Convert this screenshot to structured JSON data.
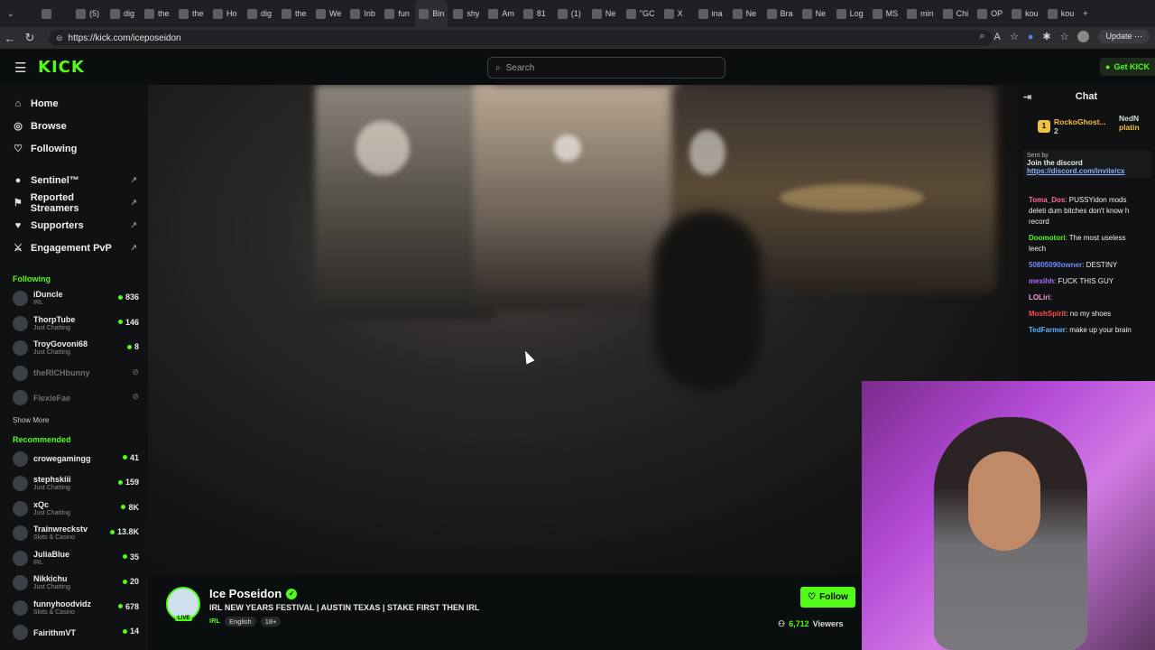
{
  "browser": {
    "tabs": [
      {
        "label": ""
      },
      {
        "label": "(5)"
      },
      {
        "label": "dig"
      },
      {
        "label": "the"
      },
      {
        "label": "the"
      },
      {
        "label": "Ho"
      },
      {
        "label": "dig"
      },
      {
        "label": "the"
      },
      {
        "label": "We"
      },
      {
        "label": "Inb"
      },
      {
        "label": "fun"
      },
      {
        "label": "Bin"
      },
      {
        "label": "shy"
      },
      {
        "label": "Am"
      },
      {
        "label": "81"
      },
      {
        "label": "(1)"
      },
      {
        "label": "Ne"
      },
      {
        "label": "\"GC"
      },
      {
        "label": "X"
      },
      {
        "label": "ina"
      },
      {
        "label": "Ne"
      },
      {
        "label": "Bra"
      },
      {
        "label": "Ne"
      },
      {
        "label": "Log"
      },
      {
        "label": "MS"
      },
      {
        "label": "min"
      },
      {
        "label": "Chi"
      },
      {
        "label": "OP"
      },
      {
        "label": "kou"
      },
      {
        "label": "kou"
      }
    ],
    "url": "https://kick.com/iceposeidon",
    "update_label": "Update"
  },
  "header": {
    "logo": "KICK",
    "search_placeholder": "Search",
    "get_kick": "Get KICK"
  },
  "sidebar": {
    "nav": [
      {
        "label": "Home",
        "icon": "home-icon"
      },
      {
        "label": "Browse",
        "icon": "compass-icon"
      },
      {
        "label": "Following",
        "icon": "heart-icon"
      }
    ],
    "extensions": [
      {
        "label": "Sentinel™"
      },
      {
        "label": "Reported Streamers"
      },
      {
        "label": "Supporters"
      },
      {
        "label": "Engagement PvP"
      }
    ],
    "following_heading": "Following",
    "following": [
      {
        "name": "iDuncle",
        "cat": "IRL",
        "viewers": "836"
      },
      {
        "name": "ThorpTube",
        "cat": "Just Chatting",
        "viewers": "146"
      },
      {
        "name": "TroyGovoni68",
        "cat": "Just Chatting",
        "viewers": "8"
      },
      {
        "name": "theRICHbunny",
        "cat": "",
        "viewers": ""
      },
      {
        "name": "FlexieFae",
        "cat": "",
        "viewers": ""
      }
    ],
    "show_more": "Show More",
    "recommended_heading": "Recommended",
    "recommended": [
      {
        "name": "crowegamingg",
        "cat": "",
        "viewers": "41"
      },
      {
        "name": "stephskiii",
        "cat": "Just Chatting",
        "viewers": "159"
      },
      {
        "name": "xQc",
        "cat": "Just Chatting",
        "viewers": "8K"
      },
      {
        "name": "Trainwreckstv",
        "cat": "Slots & Casino",
        "viewers": "13.8K"
      },
      {
        "name": "JuliaBlue",
        "cat": "IRL",
        "viewers": "35"
      },
      {
        "name": "Nikkichu",
        "cat": "Just Chatting",
        "viewers": "20"
      },
      {
        "name": "funnyhoodvidz",
        "cat": "Slots & Casino",
        "viewers": "678"
      },
      {
        "name": "FairithmVT",
        "cat": "",
        "viewers": "14"
      }
    ]
  },
  "stream": {
    "streamer": "Ice Poseidon",
    "live_badge": "LIVE",
    "title": "IRL NEW YEARS FESTIVAL | AUSTIN TEXAS | STAKE FIRST THEN IRL",
    "category": "IRL",
    "tags": [
      "English",
      "18+"
    ],
    "follow_label": "Follow",
    "viewers": "6,712",
    "viewers_label": "Viewers"
  },
  "chat": {
    "title": "Chat",
    "leader_name": "RockoGhost...",
    "leader_count": "2",
    "leader_right": "NedN",
    "leader_right2": "platin",
    "pinned_by": "Sent by",
    "pinned_text": "Join the discord",
    "pinned_link": "https://discord.com/invite/cx",
    "messages": [
      {
        "user": "Toma_Dos",
        "color": "#ff6b8a",
        "text": "PUSSYidon mods deleti dum bitches don't know h record"
      },
      {
        "user": "Doomotori",
        "color": "#53fc18",
        "text": "The most useless leech"
      },
      {
        "user": "50805090owner",
        "color": "#6f8cff",
        "text": "DESTINY"
      },
      {
        "user": "mexihh",
        "color": "#b06bff",
        "text": "FUCK THIS GUY"
      },
      {
        "user": "LOLiri",
        "color": "#ff9bd2",
        "text": ""
      },
      {
        "user": "MoshSpirit",
        "color": "#ff4d4d",
        "text": "no my shoes"
      },
      {
        "user": "TedFarmer",
        "color": "#5ab4ff",
        "text": "make up your brain"
      }
    ]
  }
}
